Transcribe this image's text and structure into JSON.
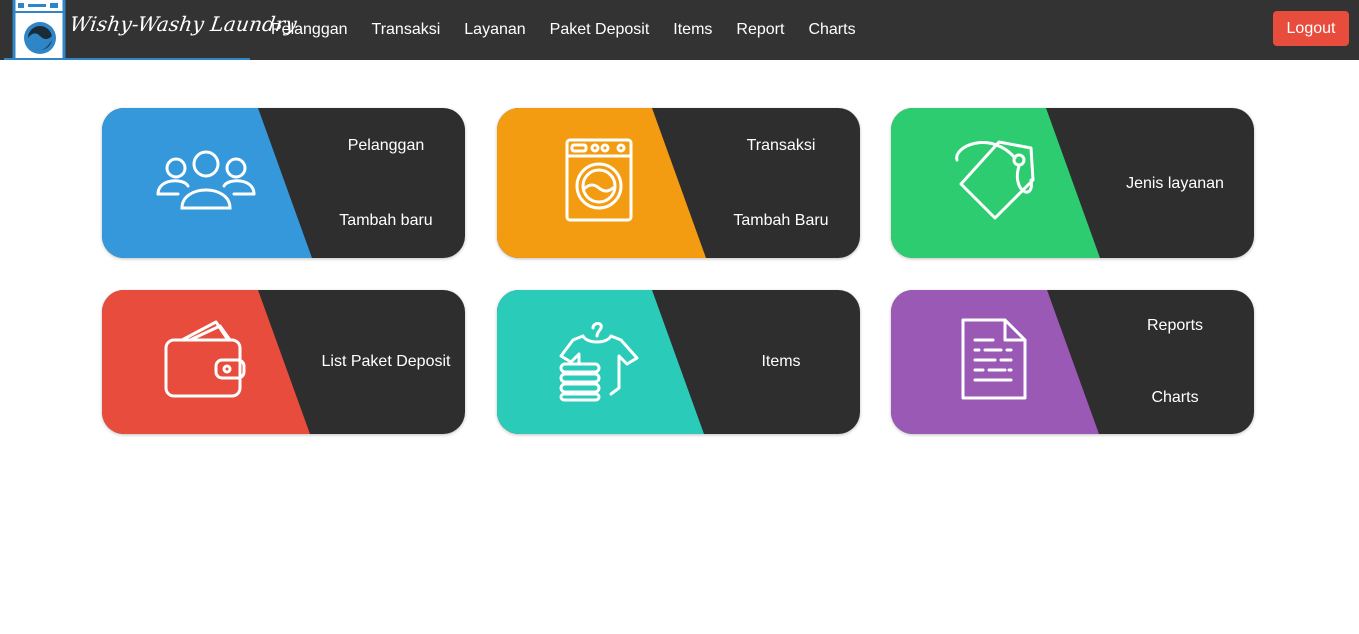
{
  "brand": {
    "name": "Wishy-Washy Laundry"
  },
  "nav": {
    "items": [
      {
        "label": "Pelanggan"
      },
      {
        "label": "Transaksi"
      },
      {
        "label": "Layanan"
      },
      {
        "label": "Paket Deposit"
      },
      {
        "label": "Items"
      },
      {
        "label": "Report"
      },
      {
        "label": "Charts"
      }
    ],
    "logout": "Logout"
  },
  "cards": [
    {
      "name": "pelanggan",
      "color": "#3498db",
      "icon": "users-icon",
      "links": [
        "Pelanggan",
        "Tambah baru"
      ]
    },
    {
      "name": "transaksi",
      "color": "#f39c12",
      "icon": "washing-machine-icon",
      "links": [
        "Transaksi",
        "Tambah Baru"
      ]
    },
    {
      "name": "layanan",
      "color": "#2ecc71",
      "icon": "tag-icon",
      "links": [
        "Jenis layanan"
      ]
    },
    {
      "name": "paket-deposit",
      "color": "#e74c3c",
      "icon": "wallet-icon",
      "links": [
        "List Paket Deposit"
      ]
    },
    {
      "name": "items",
      "color": "#2bcbba",
      "icon": "clothes-icon",
      "links": [
        "Items"
      ]
    },
    {
      "name": "reports",
      "color": "#9b59b6",
      "icon": "document-icon",
      "links": [
        "Reports",
        "Charts"
      ]
    }
  ]
}
